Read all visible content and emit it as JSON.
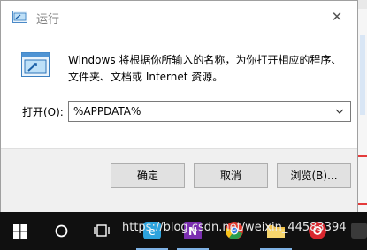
{
  "dialog": {
    "title": "运行",
    "description": "Windows 将根据你所输入的名称，为你打开相应的程序、文件夹、文档或 Internet 资源。",
    "open_label": "打开(O):",
    "open_value": "%APPDATA%",
    "buttons": {
      "ok": "确定",
      "cancel": "取消",
      "browse": "浏览(B)..."
    }
  },
  "taskbar": {
    "watermark": "https://blog.csdn.net/weixin_44583394",
    "icons": [
      "windows-start-icon",
      "search-icon",
      "task-view-icon",
      "browser-icon",
      "onenote-icon",
      "chrome-icon",
      "file-explorer-icon",
      "music-icon"
    ]
  },
  "colors": {
    "taskbar": "#101010",
    "footer": "#f0f0f0",
    "button": "#e1e1e1",
    "accent": "#0078d7"
  }
}
